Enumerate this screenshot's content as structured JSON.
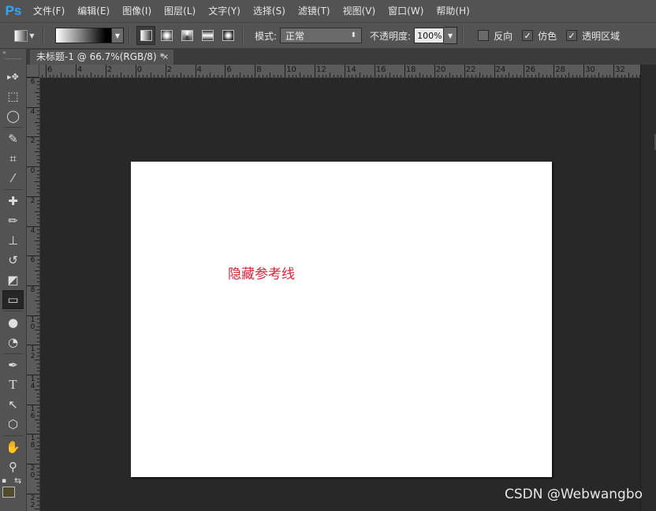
{
  "app": {
    "logo": "Ps"
  },
  "menu": [
    "文件(F)",
    "编辑(E)",
    "图像(I)",
    "图层(L)",
    "文字(Y)",
    "选择(S)",
    "滤镜(T)",
    "视图(V)",
    "窗口(W)",
    "帮助(H)"
  ],
  "options": {
    "mode_label": "模式:",
    "mode_value": "正常",
    "opacity_label": "不透明度:",
    "opacity_value": "100%",
    "reverse_label": "反向",
    "reverse_checked": false,
    "dither_label": "仿色",
    "dither_checked": true,
    "transparency_label": "透明区域",
    "transparency_checked": true
  },
  "document": {
    "tab_title": "未标题-1 @ 66.7%(RGB/8) *",
    "close_glyph": "×",
    "canvas_text": "隐藏参考线",
    "canvas_text_color": "#d9233a"
  },
  "rulers": {
    "horizontal_labels": [
      "6",
      "4",
      "2",
      "0",
      "2",
      "4",
      "6",
      "8",
      "10",
      "12",
      "14",
      "16",
      "18",
      "20",
      "22",
      "24",
      "26",
      "28",
      "30",
      "32"
    ],
    "vertical_labels": [
      "6",
      "4",
      "2",
      "0",
      "2",
      "4",
      "6",
      "8",
      "10",
      "12",
      "14",
      "16",
      "18",
      "20",
      "22"
    ]
  },
  "toolbox": {
    "tools": [
      {
        "icon": "move-icon",
        "glyph": "▸✥"
      },
      {
        "icon": "marquee-icon",
        "glyph": "⬚"
      },
      {
        "icon": "lasso-icon",
        "glyph": "◯"
      },
      {
        "icon": "quick-selection-icon",
        "glyph": "✎"
      },
      {
        "icon": "crop-icon",
        "glyph": "⌗"
      },
      {
        "icon": "eyedropper-icon",
        "glyph": "⁄"
      },
      {
        "icon": "healing-brush-icon",
        "glyph": "✚"
      },
      {
        "icon": "brush-icon",
        "glyph": "✏"
      },
      {
        "icon": "clone-stamp-icon",
        "glyph": "⊥"
      },
      {
        "icon": "history-brush-icon",
        "glyph": "↺"
      },
      {
        "icon": "eraser-icon",
        "glyph": "◩"
      },
      {
        "icon": "gradient-icon",
        "glyph": "▭"
      },
      {
        "icon": "blur-icon",
        "glyph": "●"
      },
      {
        "icon": "dodge-icon",
        "glyph": "◔"
      },
      {
        "icon": "pen-icon",
        "glyph": "✒"
      },
      {
        "icon": "type-icon",
        "glyph": "T"
      },
      {
        "icon": "path-selection-icon",
        "glyph": "↖"
      },
      {
        "icon": "shape-icon",
        "glyph": "⬡"
      },
      {
        "icon": "hand-icon",
        "glyph": "✋"
      },
      {
        "icon": "zoom-icon",
        "glyph": "⚲"
      }
    ],
    "active_tool": "gradient-icon",
    "swap_glyph": "⇆"
  },
  "watermark": "CSDN @Webwangbo",
  "colors": {
    "ps_blue": "#31a8ff",
    "panel": "#535353",
    "workspace": "#282828",
    "foreground_swatch": "#504a2e"
  }
}
